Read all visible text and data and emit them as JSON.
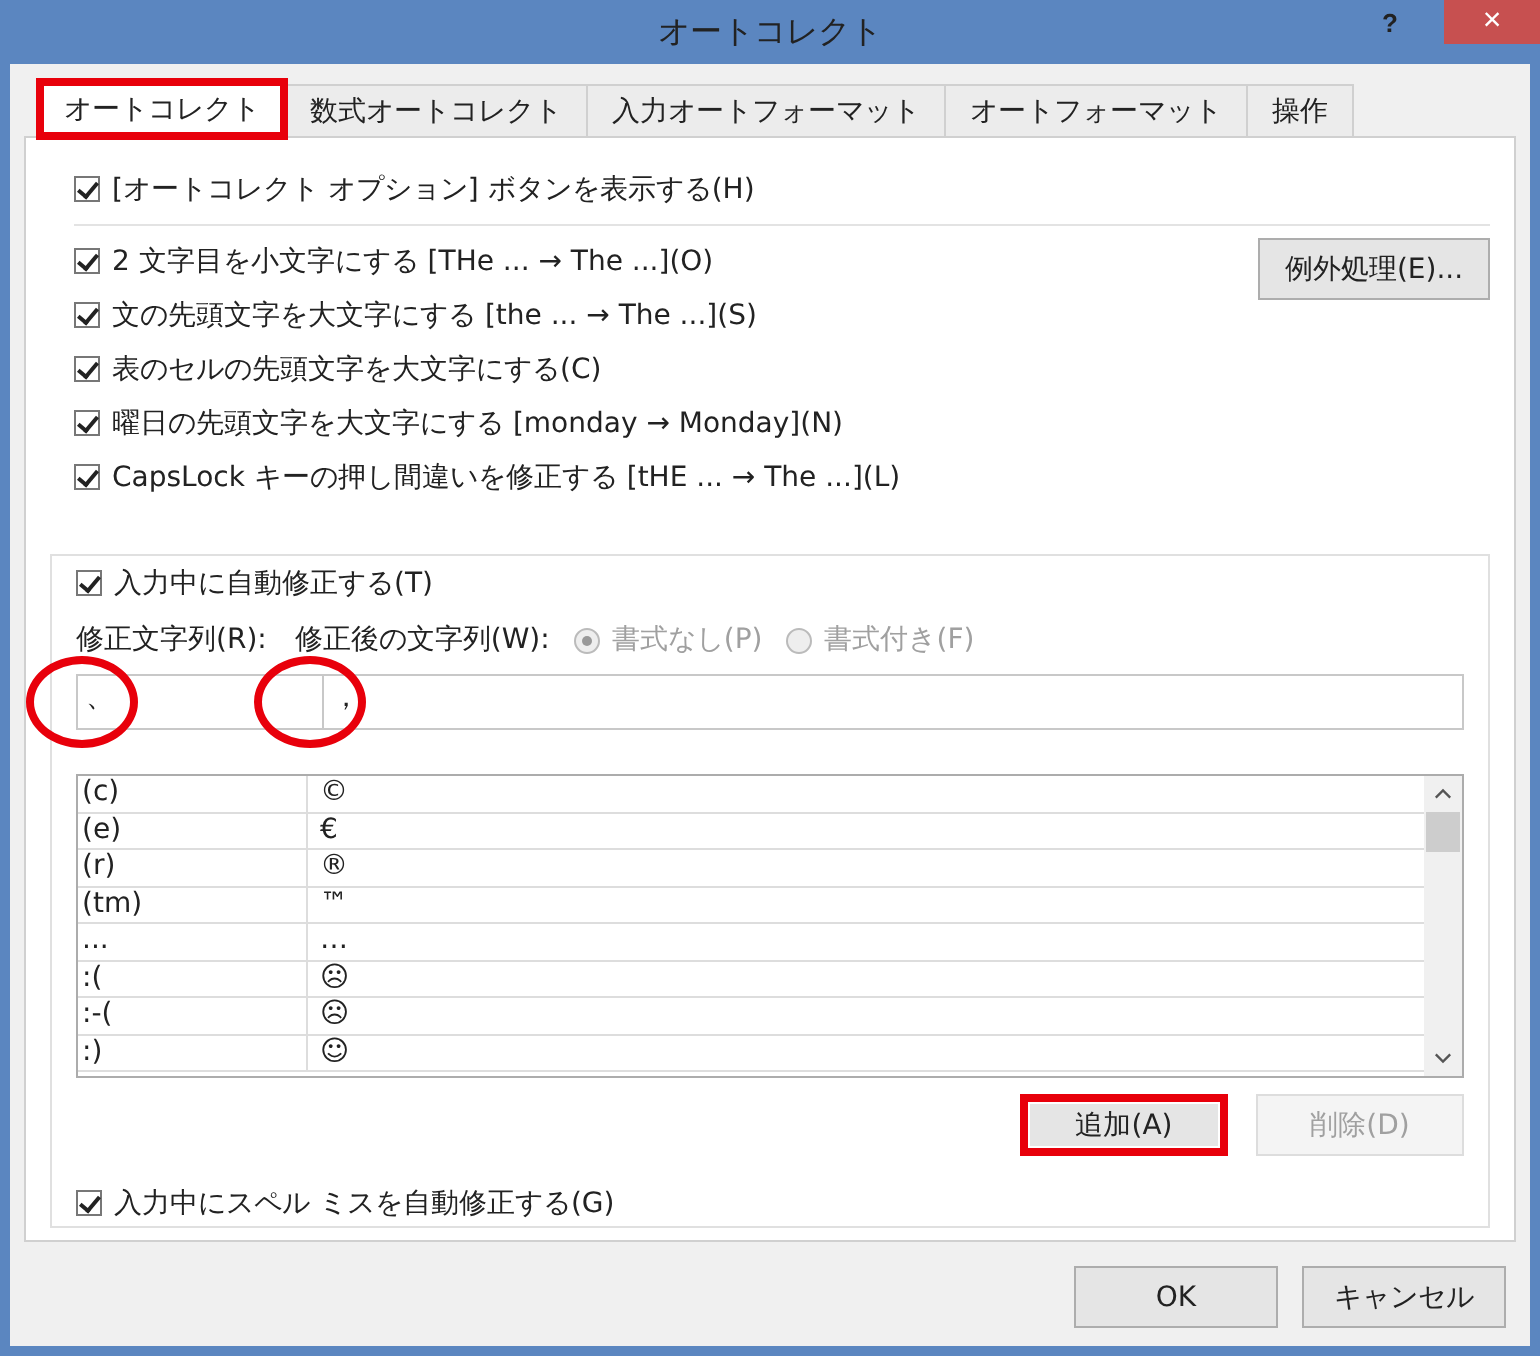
{
  "window": {
    "title": "オートコレクト",
    "help": "?",
    "close": "×"
  },
  "tabs": [
    {
      "label": "オートコレクト",
      "selected": true,
      "highlighted": true
    },
    {
      "label": "数式オートコレクト",
      "selected": false,
      "highlighted": false
    },
    {
      "label": "入力オートフォーマット",
      "selected": false,
      "highlighted": false
    },
    {
      "label": "オートフォーマット",
      "selected": false,
      "highlighted": false
    },
    {
      "label": "操作",
      "selected": false,
      "highlighted": false
    }
  ],
  "show_options_button": {
    "label": "[オートコレクト オプション] ボタンを表示する(H)",
    "checked": true
  },
  "options": [
    {
      "label": "2 文字目を小文字にする [THe ... → The ...](O)",
      "checked": true
    },
    {
      "label": "文の先頭文字を大文字にする [the ... → The ...](S)",
      "checked": true
    },
    {
      "label": "表のセルの先頭文字を大文字にする(C)",
      "checked": true
    },
    {
      "label": "曜日の先頭文字を大文字にする [monday →  Monday](N)",
      "checked": true
    },
    {
      "label": "CapsLock キーの押し間違いを修正する [tHE ... → The ...](L)",
      "checked": true
    }
  ],
  "exceptions_button": "例外処理(E)...",
  "replace_group": {
    "auto_replace": {
      "label": "入力中に自動修正する(T)",
      "checked": true
    },
    "replace_label": "修正文字列(R):",
    "with_label": "修正後の文字列(W):",
    "format_options": [
      {
        "label": "書式なし(P)",
        "selected": true,
        "disabled": true
      },
      {
        "label": "書式付き(F)",
        "selected": false,
        "disabled": true
      }
    ],
    "replace_field": {
      "value": "、",
      "circled": true
    },
    "with_field": {
      "value": "，",
      "circled": true
    },
    "table": {
      "rows": [
        [
          "(c)",
          "©"
        ],
        [
          "(e)",
          "€"
        ],
        [
          "(r)",
          "®"
        ],
        [
          "(tm)",
          "™"
        ],
        [
          "...",
          "…"
        ],
        [
          ":(",
          "☹"
        ],
        [
          ":-(",
          "☹"
        ],
        [
          ":)",
          "☺"
        ]
      ]
    },
    "buttons": [
      {
        "label": "追加(A)",
        "disabled": false,
        "highlighted": true
      },
      {
        "label": "削除(D)",
        "disabled": true,
        "highlighted": false
      }
    ],
    "spell_correct": {
      "label": "入力中にスペル ミスを自動修正する(G)",
      "checked": true
    }
  },
  "footer_buttons": [
    "OK",
    "キャンセル"
  ]
}
